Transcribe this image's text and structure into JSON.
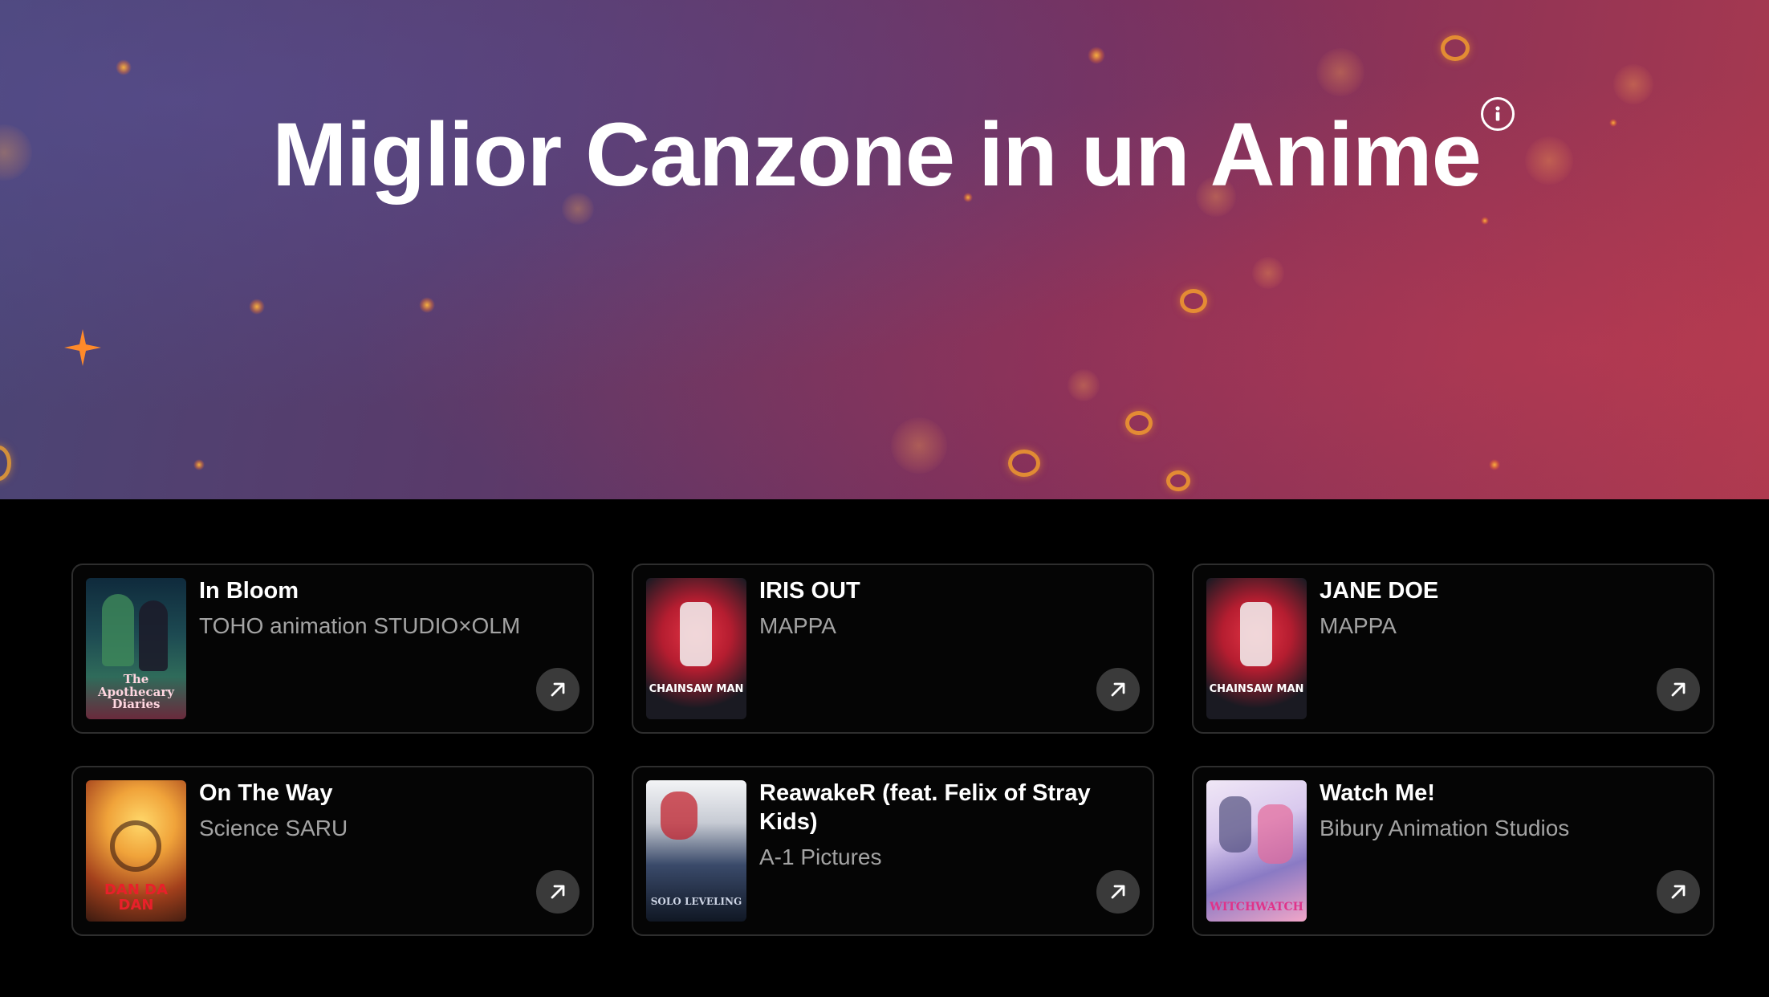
{
  "page": {
    "title": "Miglior Canzone in un Anime"
  },
  "hero": {
    "info_icon": "info-circle-icon",
    "colors": {
      "left": "#4a4676",
      "right": "#a9394f",
      "bokeh": "#ffb13c"
    }
  },
  "nominees": [
    {
      "song": "In Bloom",
      "studio": "TOHO animation STUDIO×OLM",
      "poster_text": "The Apothecary Diaries",
      "poster_colors": [
        "#16374a",
        "#2e6a5a",
        "#c9a25a"
      ]
    },
    {
      "song": "IRIS OUT",
      "studio": "MAPPA",
      "poster_text": "CHAINSAW MAN",
      "poster_colors": [
        "#1b1b22",
        "#d62a3a",
        "#0f0f14"
      ]
    },
    {
      "song": "JANE DOE",
      "studio": "MAPPA",
      "poster_text": "CHAINSAW MAN",
      "poster_colors": [
        "#1b1b22",
        "#d62a3a",
        "#0f0f14"
      ]
    },
    {
      "song": "On The Way",
      "studio": "Science SARU",
      "poster_text": "DAN DA DAN",
      "poster_colors": [
        "#f0b33c",
        "#a3401c",
        "#3a1a10"
      ]
    },
    {
      "song": "ReawakeR (feat. Felix of Stray Kids)",
      "studio": "A-1 Pictures",
      "poster_text": "SOLO LEVELING",
      "poster_colors": [
        "#eef0f3",
        "#3a4a6a",
        "#101724"
      ]
    },
    {
      "song": "Watch Me!",
      "studio": "Bibury Animation Studios",
      "poster_text": "WITCHWATCH",
      "poster_colors": [
        "#e7dcef",
        "#8a7ac4",
        "#e04d8e"
      ]
    }
  ],
  "card_action_icon": "arrow-up-right-icon"
}
